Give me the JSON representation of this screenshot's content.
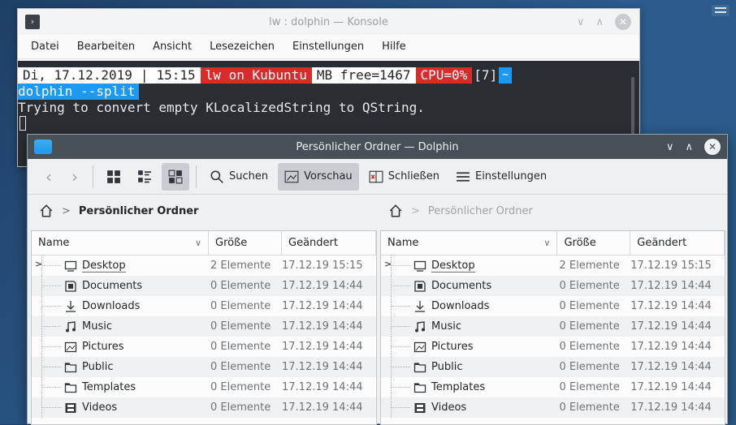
{
  "konsole": {
    "title": "lw : dolphin — Konsole",
    "menu": [
      "Datei",
      "Bearbeiten",
      "Ansicht",
      "Lesezeichen",
      "Einstellungen",
      "Hilfe"
    ],
    "prompt": {
      "date": "Di, 17.12.2019",
      "sep": "|",
      "time": "15:15",
      "host": "lw on Kubuntu",
      "mem": "MB free=1467",
      "cpu": "CPU=0%",
      "jobs": "[7]",
      "dir": "~"
    },
    "command": "dolphin --split",
    "output": "Trying to convert empty KLocalizedString to QString."
  },
  "dolphin": {
    "title": "Persönlicher Ordner — Dolphin",
    "toolbar": {
      "search": "Suchen",
      "preview": "Vorschau",
      "close": "Schließen",
      "settings": "Einstellungen"
    },
    "columns": {
      "name": "Name",
      "size": "Größe",
      "modified": "Geändert"
    },
    "left": {
      "location": "Persönlicher Ordner",
      "items": [
        {
          "name": "Desktop",
          "size": "2 Elemente",
          "date": "17.12.19 15:15",
          "icon": "desktop-icon"
        },
        {
          "name": "Documents",
          "size": "0 Elemente",
          "date": "17.12.19 14:44",
          "icon": "documents-icon"
        },
        {
          "name": "Downloads",
          "size": "0 Elemente",
          "date": "17.12.19 14:44",
          "icon": "downloads-icon"
        },
        {
          "name": "Music",
          "size": "0 Elemente",
          "date": "17.12.19 14:44",
          "icon": "music-icon"
        },
        {
          "name": "Pictures",
          "size": "0 Elemente",
          "date": "17.12.19 14:44",
          "icon": "pictures-icon"
        },
        {
          "name": "Public",
          "size": "0 Elemente",
          "date": "17.12.19 14:44",
          "icon": "folder-icon"
        },
        {
          "name": "Templates",
          "size": "0 Elemente",
          "date": "17.12.19 14:44",
          "icon": "folder-icon"
        },
        {
          "name": "Videos",
          "size": "0 Elemente",
          "date": "17.12.19 14:44",
          "icon": "videos-icon"
        }
      ]
    },
    "right": {
      "location": "Persönlicher Ordner",
      "items": [
        {
          "name": "Desktop",
          "size": "2 Elemente",
          "date": "17.12.19 15:15",
          "icon": "desktop-icon"
        },
        {
          "name": "Documents",
          "size": "0 Elemente",
          "date": "17.12.19 14:44",
          "icon": "documents-icon"
        },
        {
          "name": "Downloads",
          "size": "0 Elemente",
          "date": "17.12.19 14:44",
          "icon": "downloads-icon"
        },
        {
          "name": "Music",
          "size": "0 Elemente",
          "date": "17.12.19 14:44",
          "icon": "music-icon"
        },
        {
          "name": "Pictures",
          "size": "0 Elemente",
          "date": "17.12.19 14:44",
          "icon": "pictures-icon"
        },
        {
          "name": "Public",
          "size": "0 Elemente",
          "date": "17.12.19 14:44",
          "icon": "folder-icon"
        },
        {
          "name": "Templates",
          "size": "0 Elemente",
          "date": "17.12.19 14:44",
          "icon": "folder-icon"
        },
        {
          "name": "Videos",
          "size": "0 Elemente",
          "date": "17.12.19 14:44",
          "icon": "videos-icon"
        }
      ]
    }
  },
  "colors": {
    "accent": "#1d99f3",
    "prompt_red": "#da2b2b",
    "terminal_bg": "#2a2e32",
    "titlebar_active": "#475057"
  }
}
